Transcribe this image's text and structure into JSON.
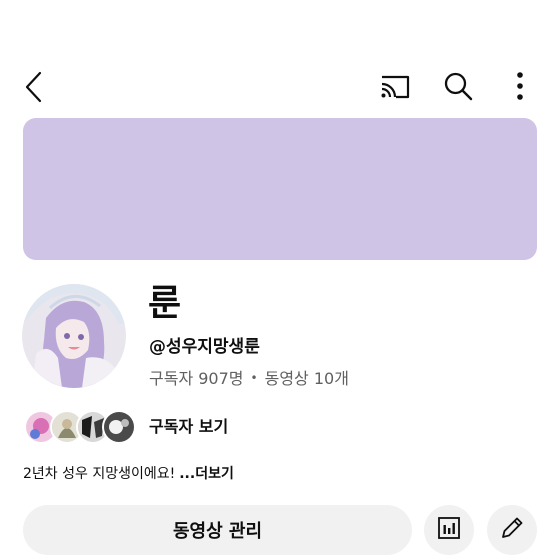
{
  "colors": {
    "banner": "#cfc3e6",
    "text_primary": "#0f0f0f",
    "text_secondary": "#606060",
    "button_bg": "#f1f1f1"
  },
  "top_bar": {
    "icons": [
      "back-icon",
      "cast-icon",
      "search-icon",
      "more-vertical-icon"
    ]
  },
  "channel": {
    "name": "룬",
    "handle": "@성우지망생룬",
    "subscribers": "구독자 907명",
    "separator": "•",
    "videos": "동영상 10개",
    "view_subscribers": "구독자 보기",
    "description": "2년차 성우 지망생이에요!",
    "more": "...더보기"
  },
  "actions": {
    "manage_videos": "동영상 관리",
    "analytics_icon": "analytics-icon",
    "edit_icon": "pencil-icon"
  }
}
